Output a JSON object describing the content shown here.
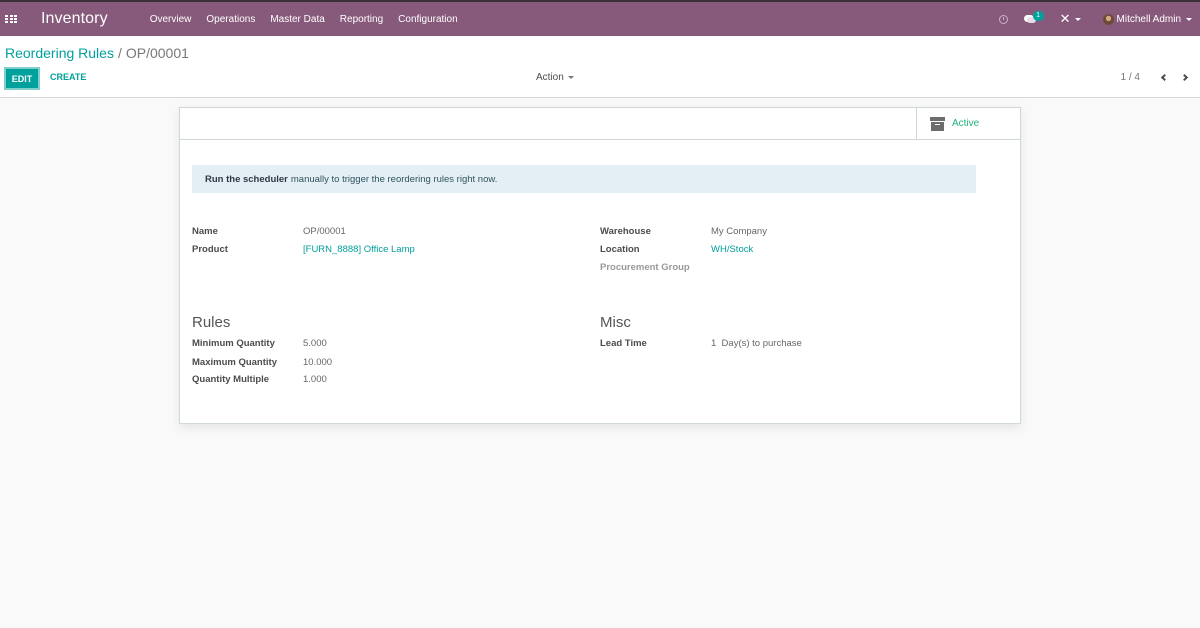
{
  "navbar": {
    "app_name": "Inventory",
    "menu": [
      "Overview",
      "Operations",
      "Master Data",
      "Reporting",
      "Configuration"
    ],
    "icons": [
      "apps-grid-icon",
      "clock-icon",
      "chat-icon",
      "debug-icon",
      "user-avatar"
    ],
    "messages_badge": "1",
    "user_name": "Mitchell Admin",
    "color": "#875a7b"
  },
  "breadcrumb": {
    "parent": "Reordering Rules",
    "separator": "/",
    "current": "OP/00001"
  },
  "toolbar": {
    "edit_label": "EDIT",
    "create_label": "CREATE",
    "action_label": "Action",
    "pager_value": "1 / 4",
    "accent_color": "#00a09d"
  },
  "sheet": {
    "status_button": "Active",
    "alert": {
      "bold": "Run the scheduler",
      "text": "manually to trigger the reordering rules right now."
    },
    "left_fields": [
      {
        "label": "Name",
        "value": "OP/00001"
      },
      {
        "label": "Product",
        "value": "[FURN_8888] Office Lamp"
      }
    ],
    "right_fields": [
      {
        "label": "Warehouse",
        "value": "My Company"
      },
      {
        "label": "Location",
        "value": "WH/Stock"
      },
      {
        "label": "Procurement Group",
        "value": ""
      }
    ],
    "rules": {
      "title": "Rules",
      "fields": [
        {
          "label": "Minimum Quantity",
          "value": "5.000"
        },
        {
          "label": "Maximum Quantity",
          "value": "10.000"
        },
        {
          "label": "Quantity Multiple",
          "value": "1.000"
        }
      ]
    },
    "misc": {
      "title": "Misc",
      "fields": [
        {
          "label": "Lead Time",
          "value": "1  Day(s) to purchase"
        }
      ]
    }
  }
}
